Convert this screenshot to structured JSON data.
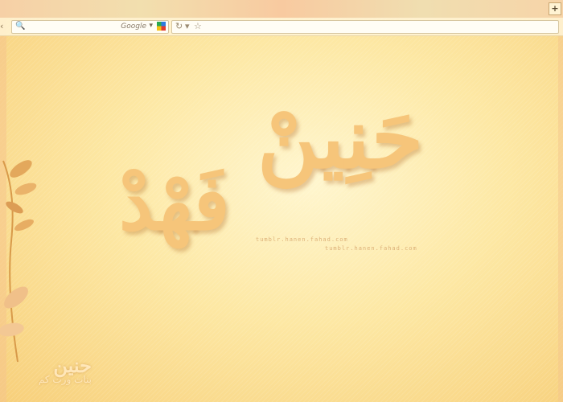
{
  "window": {
    "corner_button_label": "+"
  },
  "toolbar": {
    "left_arrow": "‹",
    "search": {
      "engine_label": "Google",
      "icon": "search-icon",
      "dropdown_icon": "chevron-down-icon",
      "engine_icon": "google-icon"
    },
    "address": {
      "reload_glyph": "↻",
      "dropdown_glyph": "▾",
      "star_glyph": "☆"
    }
  },
  "wallpaper": {
    "name_top": "حَنِينْ",
    "name_bottom": "فَهْدْ",
    "watermark_1": "tumblr.hanen.fahad.com",
    "watermark_2": "tumblr.hanen.fahad.com",
    "signature_big": "حنين",
    "signature_small": "بنات ورت كم",
    "colors": {
      "background": "#fde8a4",
      "calligraphy": "#f6c57a"
    }
  }
}
